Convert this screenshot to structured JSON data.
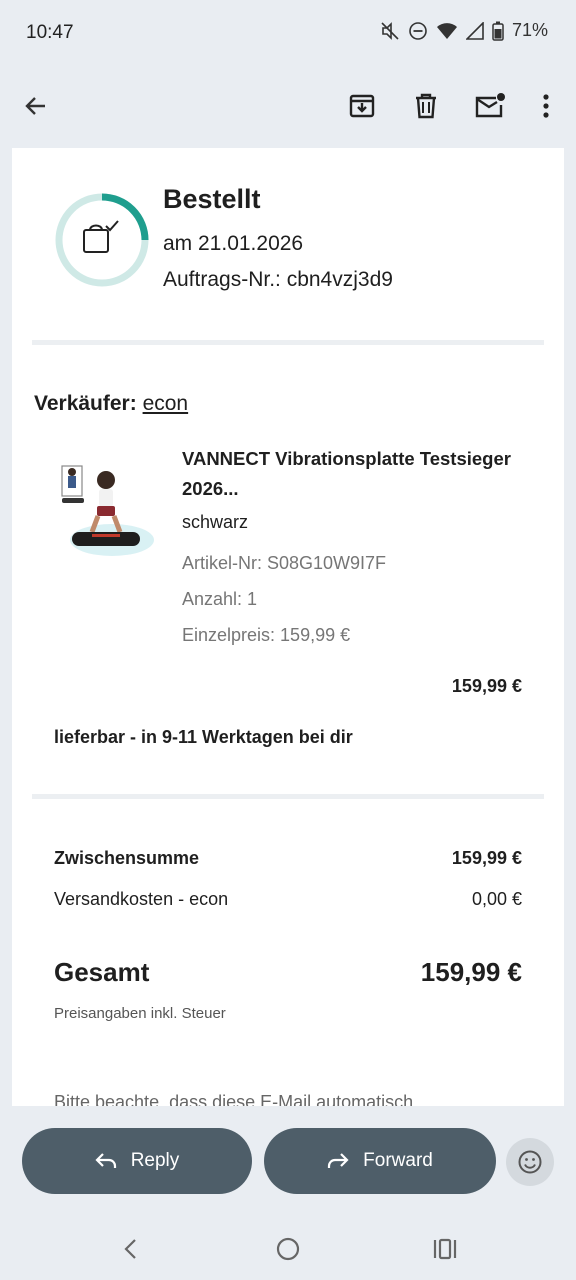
{
  "status": {
    "time": "10:47",
    "battery": "71%"
  },
  "order": {
    "status_title": "Bestellt",
    "date": "am 21.01.2026",
    "order_number": "Auftrags-Nr.: cbn4vzj3d9"
  },
  "seller": {
    "label": "Verkäufer:",
    "name": "econ"
  },
  "product": {
    "name": "VANNECT Vibrationsplatte Testsieger 2026...",
    "variant": "schwarz",
    "article_number": "Artikel-Nr: S08G10W9I7F",
    "quantity": "Anzahl: 1",
    "unit_price": "Einzelpreis: 159,99 €",
    "line_total": "159,99 €",
    "image_icon": "product-photo"
  },
  "delivery": "lieferbar - in 9-11 Werktagen bei dir",
  "summary": {
    "subtotal_label": "Zwischensumme",
    "subtotal_value": "159,99 €",
    "shipping_label": "Versandkosten - econ",
    "shipping_value": "0,00 €",
    "total_label": "Gesamt",
    "total_value": "159,99 €",
    "tax_note": "Preisangaben inkl. Steuer"
  },
  "footer_text": "Bitte beachte, dass diese E-Mail automatisch",
  "actions": {
    "reply": "Reply",
    "forward": "Forward"
  },
  "colors": {
    "progress_ring": "#1f9e8e",
    "ring_bg": "#cfe9e6",
    "action_pill": "#4e5e69",
    "page_bg": "#e9edf2"
  }
}
